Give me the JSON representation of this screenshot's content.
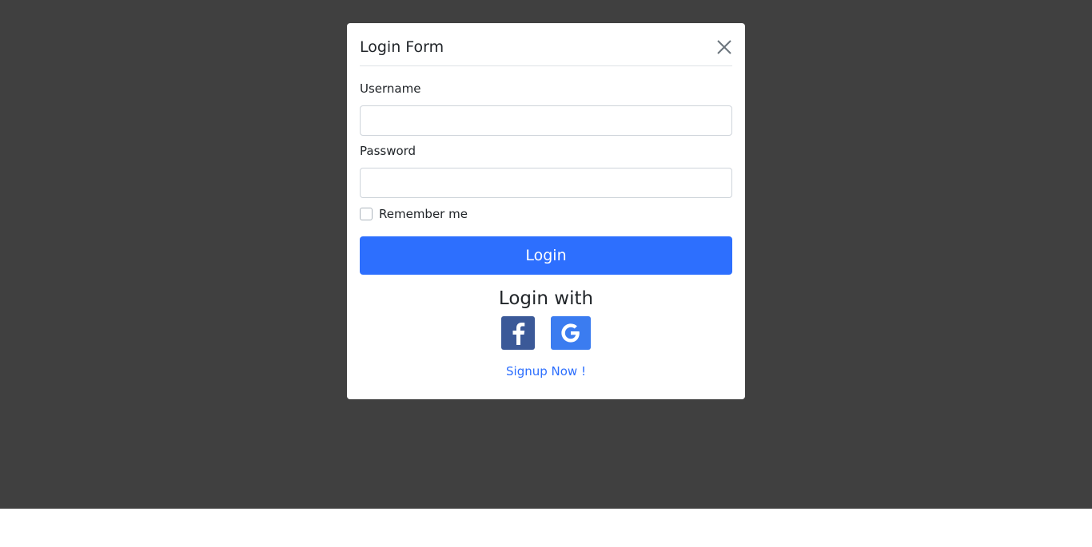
{
  "modal": {
    "title": "Login Form",
    "close_icon": "close-icon"
  },
  "form": {
    "username_label": "Username",
    "username_value": "",
    "username_placeholder": "",
    "password_label": "Password",
    "password_value": "",
    "password_placeholder": "",
    "remember_label": "Remember me",
    "remember_checked": false,
    "login_button": "Login"
  },
  "social": {
    "heading": "Login with",
    "facebook_icon": "facebook-icon",
    "google_icon": "google-icon",
    "facebook_color": "#3b5998",
    "google_color": "#3b7cf0"
  },
  "signup_link": "Signup Now !",
  "colors": {
    "backdrop": "#404040",
    "primary": "#2d6ffe"
  }
}
